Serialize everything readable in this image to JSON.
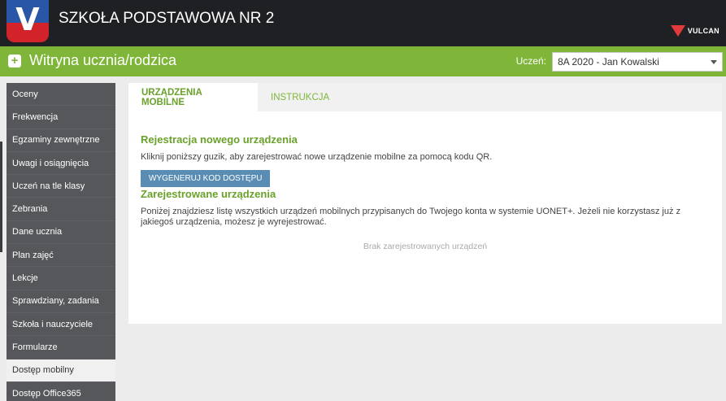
{
  "header": {
    "school_name": "SZKOŁA PODSTAWOWA NR 2",
    "logo_letter": "V",
    "brand_name": "VULCAN"
  },
  "greenbar": {
    "title": "Witryna ucznia/rodzica",
    "student_label": "Uczeń:",
    "student_value": "8A 2020 - Jan Kowalski"
  },
  "sidebar": {
    "items": [
      {
        "label": "Oceny"
      },
      {
        "label": "Frekwencja"
      },
      {
        "label": "Egzaminy zewnętrzne"
      },
      {
        "label": "Uwagi i osiągnięcia"
      },
      {
        "label": "Uczeń na tle klasy"
      },
      {
        "label": "Zebrania"
      },
      {
        "label": "Dane ucznia"
      },
      {
        "label": "Plan zajęć"
      },
      {
        "label": "Lekcje"
      },
      {
        "label": "Sprawdziany, zadania"
      },
      {
        "label": "Szkoła i nauczyciele"
      },
      {
        "label": "Formularze"
      },
      {
        "label": "Dostęp mobilny"
      },
      {
        "label": "Dostęp Office365"
      }
    ]
  },
  "tabs": {
    "active": "URZĄDZENIA MOBILNE",
    "inactive": "INSTRUKCJA"
  },
  "content": {
    "register_title": "Rejestracja nowego urządzenia",
    "register_text": "Kliknij poniższy guzik, aby zarejestrować nowe urządzenie mobilne za pomocą kodu QR.",
    "generate_button": "WYGENERUJ KOD DOSTĘPU",
    "registered_title": "Zarejestrowane urządzenia",
    "registered_text": "Poniżej znajdziesz listę wszystkich urządzeń mobilnych przypisanych do Twojego konta w systemie UONET+. Jeżeli nie korzystasz już z jakiegoś urządzenia, możesz je wyrejestrować.",
    "empty_text": "Brak zarejestrowanych urządzeń"
  },
  "colors": {
    "accent_green": "#7fb539",
    "sidebar_bg": "#56575a",
    "button_blue": "#5a8db4",
    "topbar_bg": "#1f2023"
  }
}
